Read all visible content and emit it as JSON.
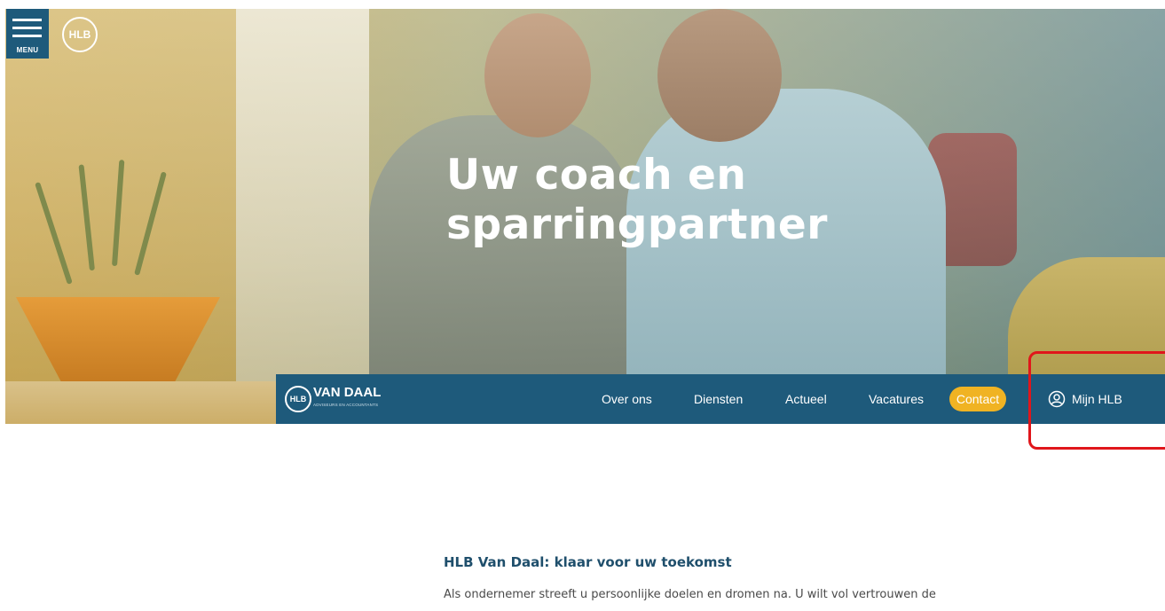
{
  "header": {
    "menu_label": "MENU",
    "logo_text": "HLB"
  },
  "hero": {
    "title_line1": "Uw coach en",
    "title_line2": "sparringpartner"
  },
  "navbar": {
    "logo_mark": "HLB",
    "logo_brand": "VAN DAAL",
    "logo_subtitle": "ADVISEURS EN ACCOUNTANTS",
    "items": [
      {
        "label": "Over ons"
      },
      {
        "label": "Diensten"
      },
      {
        "label": "Actueel"
      },
      {
        "label": "Vacatures"
      }
    ],
    "contact_label": "Contact",
    "account_label": "Mijn HLB",
    "account_icon": "user-circle-icon"
  },
  "content": {
    "heading": "HLB Van Daal: klaar voor uw toekomst",
    "intro": "Als ondernemer streeft u persoonlijke doelen en dromen na. U wilt vol vertrouwen de"
  },
  "colors": {
    "navy": "#1e5a7b",
    "contact": "#f0b323",
    "highlight": "#e0161b",
    "heading": "#1f4f6c"
  }
}
